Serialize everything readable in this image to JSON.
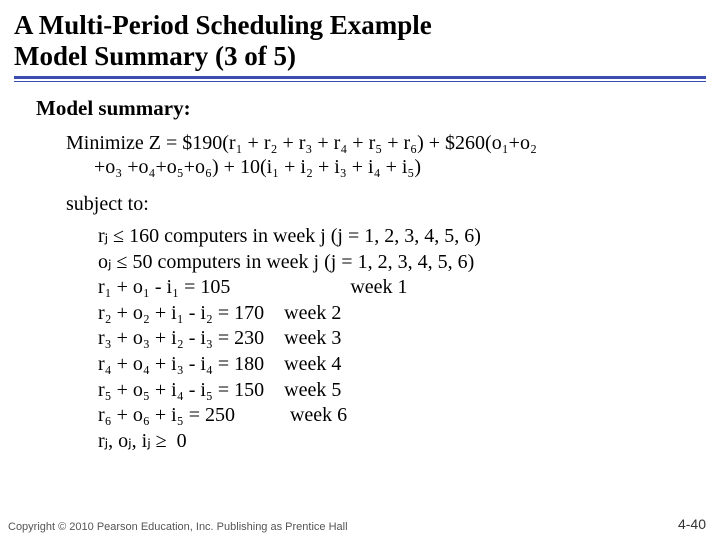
{
  "title_line1": "A Multi-Period Scheduling Example",
  "title_line2": "Model Summary (3 of 5)",
  "section": "Model summary:",
  "objective_l1": "Minimize Z = $190(r₁ + r₂ + r₃ + r₄ + r₅ + r₆) + $260(o₁+o₂",
  "objective_l2": "+o₃ +o₄+o₅+o₆) + 10(i₁ + i₂ + i₃ + i₄ + i₅)",
  "subject_to": "subject to:",
  "c_r": "rⱼ ≤ 160 computers in week j (j = 1, 2, 3, 4, 5, 6)",
  "c_o": "oⱼ ≤ 50 computers in week j (j = 1, 2, 3, 4, 5, 6)",
  "c1": "r₁ + o₁ - i₁ = 105                        week 1",
  "c2": "r₂ + o₂ + i₁ - i₂ = 170    week 2",
  "c3": "r₃ + o₃ + i₂ - i₃ = 230    week 3",
  "c4": "r₄ + o₄ + i₃ - i₄ = 180    week 4",
  "c5": "r₅ + o₅ + i₄ - i₅ = 150    week 5",
  "c6": "r₆ + o₆ + i₅ = 250           week 6",
  "c7": "rⱼ, oⱼ, iⱼ ≥  0",
  "copyright": "Copyright © 2010 Pearson Education, Inc. Publishing as Prentice Hall",
  "pagenum": "4-40"
}
